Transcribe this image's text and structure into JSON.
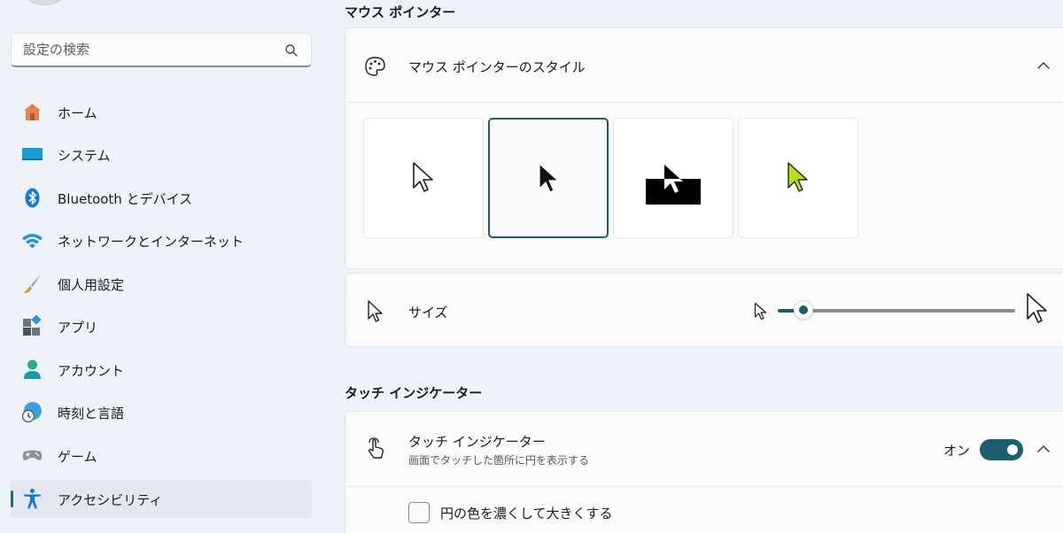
{
  "search": {
    "placeholder": "設定の検索"
  },
  "sidebar": {
    "items": [
      {
        "label": "ホーム",
        "icon": "home-icon"
      },
      {
        "label": "システム",
        "icon": "system-icon"
      },
      {
        "label": "Bluetooth とデバイス",
        "icon": "bluetooth-icon"
      },
      {
        "label": "ネットワークとインターネット",
        "icon": "wifi-icon"
      },
      {
        "label": "個人用設定",
        "icon": "brush-icon"
      },
      {
        "label": "アプリ",
        "icon": "apps-icon"
      },
      {
        "label": "アカウント",
        "icon": "account-icon"
      },
      {
        "label": "時刻と言語",
        "icon": "time-language-icon"
      },
      {
        "label": "ゲーム",
        "icon": "gamepad-icon"
      },
      {
        "label": "アクセシビリティ",
        "icon": "accessibility-icon",
        "active": true
      }
    ]
  },
  "main": {
    "pointer_section_title": "マウス ポインター",
    "pointer_style": {
      "label": "マウス ポインターのスタイル",
      "selected_index": 1
    },
    "size": {
      "label": "サイズ",
      "value_fraction": 0.11
    },
    "touch_section_title": "タッチ インジケーター",
    "touch_indicator": {
      "label": "タッチ インジケーター",
      "description": "画面でタッチした箇所に円を表示する",
      "state_label": "オン"
    },
    "darker_circle": {
      "label": "円の色を濃くして大きくする"
    }
  },
  "colors": {
    "accent": "#1b5e6e",
    "background": "#eef3f9",
    "card": "#fbfbfc"
  }
}
